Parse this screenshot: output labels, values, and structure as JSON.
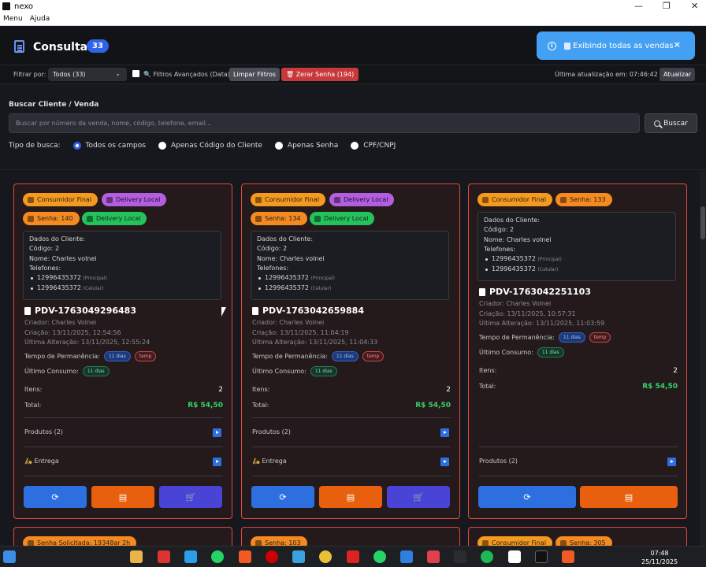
{
  "window": {
    "title": "nexo",
    "controls": [
      "—",
      "❐",
      "✕"
    ]
  },
  "menu": [
    "Menu",
    "Ajuda"
  ],
  "header": {
    "title": "Consultar",
    "badge": "33"
  },
  "toast": {
    "text": "Exibindo todas as vendas",
    "close": "×"
  },
  "filters": {
    "label": "Filtrar por:",
    "select_value": "Todos (33)",
    "advanced": "🔍 Filtros Avançados (Data)",
    "clear": "Limpar Filtros",
    "reset": "🗑 Zerar Senha (194)",
    "updated": "Última atualização em: 07:46:42",
    "refresh": "Atualizar"
  },
  "search": {
    "label": "Buscar Cliente / Venda",
    "placeholder": "Buscar por número da venda, nome, código, telefone, email...",
    "button": "Buscar",
    "type_label": "Tipo de busca:",
    "options": [
      "Todos os campos",
      "Apenas Código do Cliente",
      "Apenas Senha",
      "CPF/CNPJ"
    ]
  },
  "colors": {
    "accent": "#2f63e8",
    "card_border": "#e0483c",
    "money": "#34d36a",
    "toast": "#43a0f2"
  },
  "cards": [
    {
      "chips": [
        "Consumidor Final",
        "Delivery Local",
        "Senha: 140",
        "Delivery Local"
      ],
      "client": {
        "title": "Dados do Cliente:",
        "code": "Código: 2",
        "name": "Nome: Charles volnei",
        "phones_label": "Telefones:",
        "phones": [
          {
            "n": "12996435372",
            "t": "(Principal)"
          },
          {
            "n": "12996435372",
            "t": "(Celular)"
          }
        ]
      },
      "pdv": "PDV-1763049296483",
      "creator": "Criador: Charles Volnei",
      "created": "Criação: 13/11/2025, 12:54:56",
      "altered": "Última Alteração: 13/11/2025, 12:55:24",
      "perm_label": "Tempo de Permanência:",
      "perm_days": "11 dias",
      "perm_tag": "temp",
      "consumo_label": "Último Consumo:",
      "consumo_days": "11 dias",
      "items_label": "Itens:",
      "items": "2",
      "total_label": "Total:",
      "total": "R$ 54,50",
      "products": "Produtos (2)",
      "delivery": "🛵 Entrega"
    },
    {
      "chips": [
        "Consumidor Final",
        "Delivery Local",
        "Senha: 134",
        "Delivery Local"
      ],
      "client": {
        "title": "Dados do Cliente:",
        "code": "Código: 2",
        "name": "Nome: Charles volnei",
        "phones_label": "Telefones:",
        "phones": [
          {
            "n": "12996435372",
            "t": "(Principal)"
          },
          {
            "n": "12996435372",
            "t": "(Celular)"
          }
        ]
      },
      "pdv": "PDV-1763042659884",
      "creator": "Criador: Charles Volnei",
      "created": "Criação: 13/11/2025, 11:04:19",
      "altered": "Última Alteração: 13/11/2025, 11:04:33",
      "perm_label": "Tempo de Permanência:",
      "perm_days": "11 dias",
      "perm_tag": "temp",
      "consumo_label": "Último Consumo:",
      "consumo_days": "11 dias",
      "items_label": "Itens:",
      "items": "2",
      "total_label": "Total:",
      "total": "R$ 54,50",
      "products": "Produtos (2)",
      "delivery": "🛵 Entrega"
    },
    {
      "chips": [
        "Consumidor Final",
        "Senha: 133"
      ],
      "client": {
        "title": "Dados do Cliente:",
        "code": "Código: 2",
        "name": "Nome: Charles volnei",
        "phones_label": "Telefones:",
        "phones": [
          {
            "n": "12996435372",
            "t": "(Principal)"
          },
          {
            "n": "12996435372",
            "t": "(Celular)"
          }
        ]
      },
      "pdv": "PDV-1763042251103",
      "creator": "Criador: Charles Volnei",
      "created": "Criação: 13/11/2025, 10:57:31",
      "altered": "Última Alteração: 13/11/2025, 11:03:59",
      "perm_label": "Tempo de Permanência:",
      "perm_days": "11 dias",
      "perm_tag": "temp",
      "consumo_label": "Último Consumo:",
      "consumo_days": "11 dias",
      "items_label": "Itens:",
      "items": "2",
      "total_label": "Total:",
      "total": "R$ 54,50",
      "products": "Produtos (2)"
    }
  ],
  "next_row_chips": [
    "Senha Solicitada: 19348ar 2h",
    "Senha: 103",
    "Consumidor Final",
    "Senha: 305"
  ],
  "taskbar": {
    "time": "07:48",
    "date": "25/11/2025"
  }
}
